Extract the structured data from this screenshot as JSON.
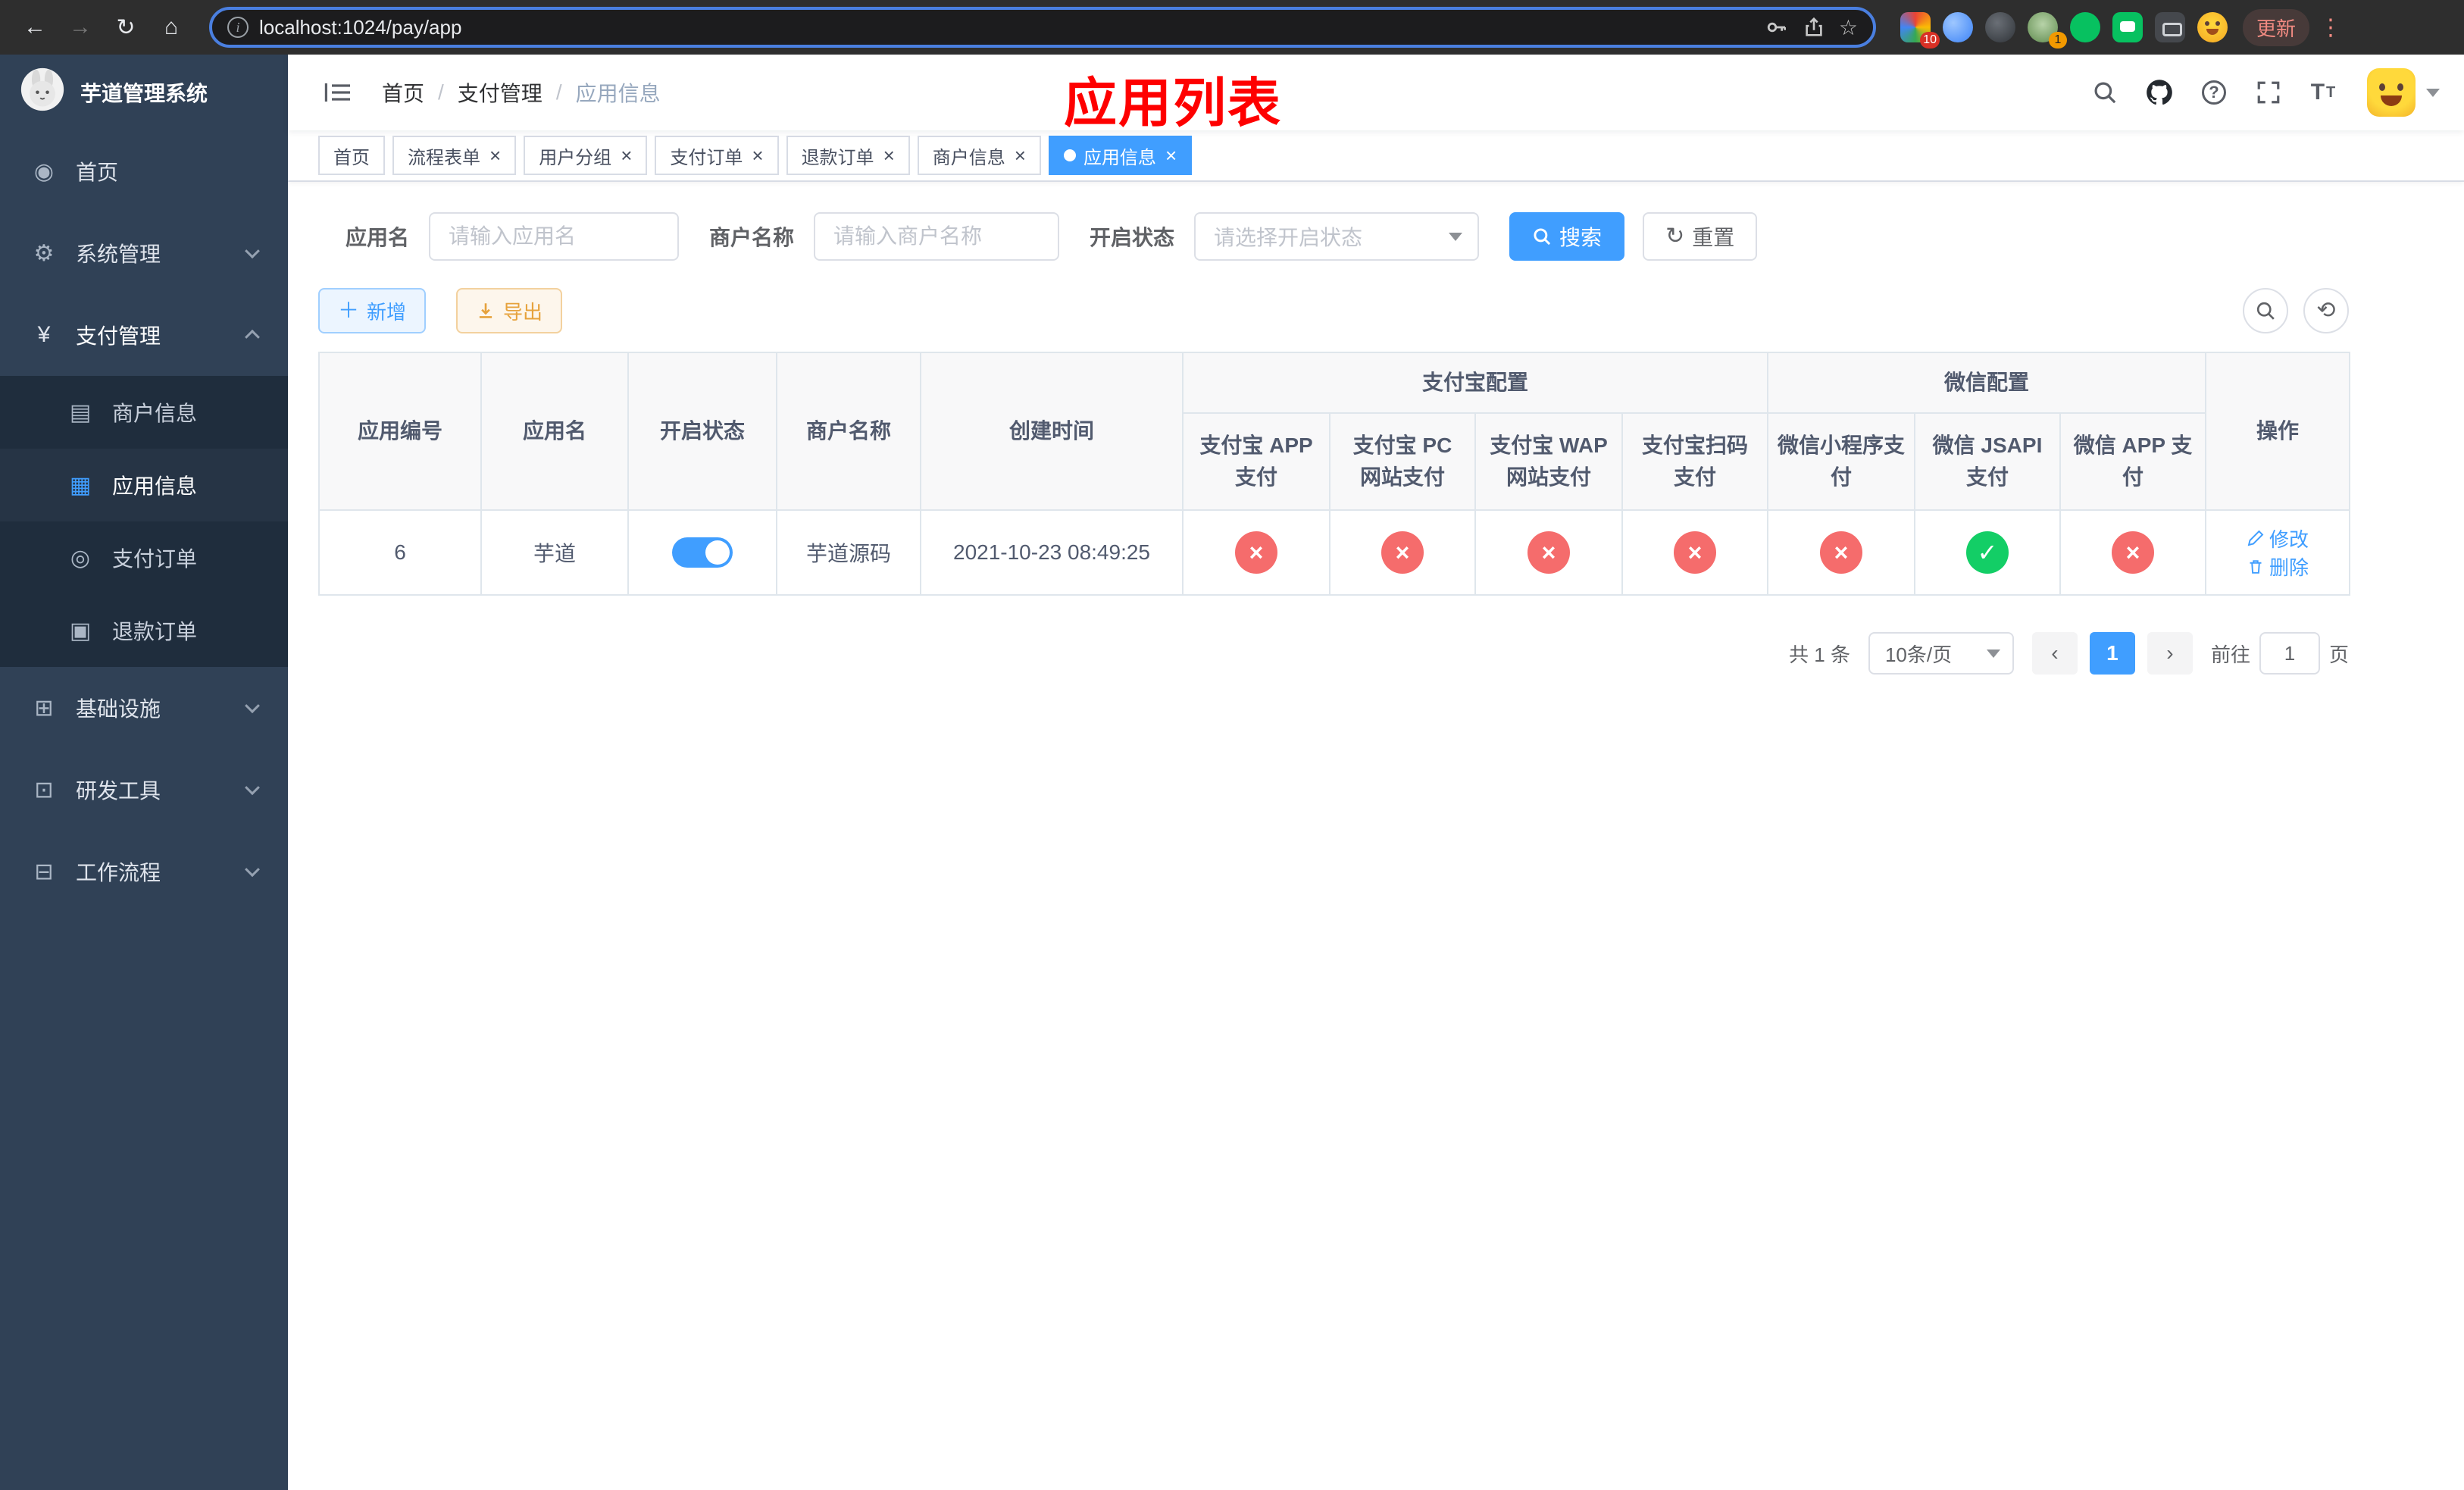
{
  "browser": {
    "url": "localhost:1024/pay/app",
    "update_label": "更新",
    "ext_badge_1": "10",
    "ext_badge_2": "1"
  },
  "annotation": {
    "title": "应用列表"
  },
  "sidebar": {
    "app_title": "芋道管理系统",
    "items": [
      {
        "label": "首页",
        "icon": "dashboard-icon"
      },
      {
        "label": "系统管理",
        "icon": "gear-icon"
      },
      {
        "label": "支付管理",
        "icon": "yen-icon"
      },
      {
        "label": "商户信息",
        "icon": "merchant-card-icon"
      },
      {
        "label": "应用信息",
        "icon": "app-grid-icon"
      },
      {
        "label": "支付订单",
        "icon": "pay-order-icon"
      },
      {
        "label": "退款订单",
        "icon": "refund-order-icon"
      },
      {
        "label": "基础设施",
        "icon": "infrastructure-icon"
      },
      {
        "label": "研发工具",
        "icon": "devtools-icon"
      },
      {
        "label": "工作流程",
        "icon": "workflow-icon"
      }
    ]
  },
  "breadcrumb": {
    "separator": "/",
    "items": [
      "首页",
      "支付管理",
      "应用信息"
    ]
  },
  "tabs": [
    {
      "label": "首页"
    },
    {
      "label": "流程表单"
    },
    {
      "label": "用户分组"
    },
    {
      "label": "支付订单"
    },
    {
      "label": "退款订单"
    },
    {
      "label": "商户信息"
    },
    {
      "label": "应用信息"
    }
  ],
  "filters": {
    "app_name_label": "应用名",
    "app_name_placeholder": "请输入应用名",
    "merchant_label": "商户名称",
    "merchant_placeholder": "请输入商户名称",
    "status_label": "开启状态",
    "status_placeholder": "请选择开启状态",
    "search_label": "搜索",
    "reset_label": "重置"
  },
  "toolbar": {
    "add_label": "新增",
    "export_label": "导出"
  },
  "table": {
    "headers": {
      "app_id": "应用编号",
      "app_name": "应用名",
      "status": "开启状态",
      "merchant": "商户名称",
      "created": "创建时间",
      "alipay_group": "支付宝配置",
      "wechat_group": "微信配置",
      "alipay_app": "支付宝 APP 支付",
      "alipay_pc": "支付宝 PC 网站支付",
      "alipay_wap": "支付宝 WAP 网站支付",
      "alipay_qr": "支付宝扫码支付",
      "wx_mini": "微信小程序支付",
      "wx_jsapi": "微信 JSAPI 支付",
      "wx_app": "微信 APP 支付",
      "actions": "操作"
    },
    "rows": [
      {
        "app_id": "6",
        "app_name": "芋道",
        "status_on": true,
        "merchant": "芋道源码",
        "created": "2021-10-23 08:49:25",
        "alipay_app": "fail",
        "alipay_pc": "fail",
        "alipay_wap": "fail",
        "alipay_qr": "fail",
        "wx_mini": "fail",
        "wx_jsapi": "success",
        "wx_app": "fail",
        "edit_label": "修改",
        "delete_label": "删除"
      }
    ]
  },
  "pagination": {
    "total_text": "共 1 条",
    "page_size": "10条/页",
    "current_page": "1",
    "goto_label": "前往",
    "goto_value": "1",
    "page_label": "页"
  },
  "colors": {
    "accent": "#409eff",
    "success": "#13ce66",
    "danger": "#f56c6c",
    "sidebar_bg": "#304156",
    "annotation_red": "#fe0000"
  }
}
